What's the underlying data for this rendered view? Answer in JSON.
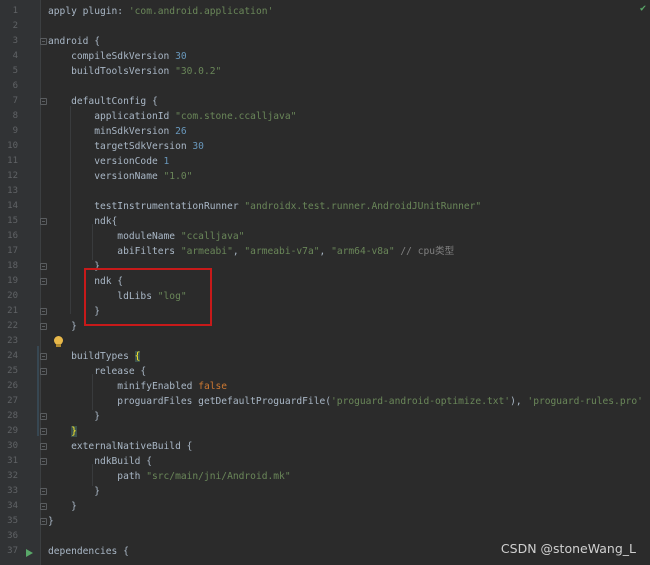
{
  "editor": {
    "lines": [
      {
        "n": "1",
        "segs": [
          [
            "p",
            "apply "
          ],
          [
            "p",
            "plugin: "
          ],
          [
            "s",
            "'com.android.application'"
          ]
        ]
      },
      {
        "n": "2",
        "segs": []
      },
      {
        "n": "3",
        "segs": [
          [
            "p",
            "android {"
          ]
        ]
      },
      {
        "n": "4",
        "segs": [
          [
            "p",
            "    compileSdkVersion "
          ],
          [
            "n",
            "30"
          ]
        ]
      },
      {
        "n": "5",
        "segs": [
          [
            "p",
            "    buildToolsVersion "
          ],
          [
            "s",
            "\"30.0.2\""
          ]
        ]
      },
      {
        "n": "6",
        "segs": []
      },
      {
        "n": "7",
        "segs": [
          [
            "p",
            "    defaultConfig {"
          ]
        ]
      },
      {
        "n": "8",
        "segs": [
          [
            "p",
            "        applicationId "
          ],
          [
            "s",
            "\"com.stone.ccalljava\""
          ]
        ]
      },
      {
        "n": "9",
        "segs": [
          [
            "p",
            "        minSdkVersion "
          ],
          [
            "n",
            "26"
          ]
        ]
      },
      {
        "n": "10",
        "segs": [
          [
            "p",
            "        targetSdkVersion "
          ],
          [
            "n",
            "30"
          ]
        ]
      },
      {
        "n": "11",
        "segs": [
          [
            "p",
            "        versionCode "
          ],
          [
            "n",
            "1"
          ]
        ]
      },
      {
        "n": "12",
        "segs": [
          [
            "p",
            "        versionName "
          ],
          [
            "s",
            "\"1.0\""
          ]
        ]
      },
      {
        "n": "13",
        "segs": []
      },
      {
        "n": "14",
        "segs": [
          [
            "p",
            "        testInstrumentationRunner "
          ],
          [
            "s",
            "\"androidx.test.runner.AndroidJUnitRunner\""
          ]
        ]
      },
      {
        "n": "15",
        "segs": [
          [
            "p",
            "        ndk{"
          ]
        ]
      },
      {
        "n": "16",
        "segs": [
          [
            "p",
            "            moduleName "
          ],
          [
            "s",
            "\"ccalljava\""
          ]
        ]
      },
      {
        "n": "17",
        "segs": [
          [
            "p",
            "            abiFilters "
          ],
          [
            "s",
            "\"armeabi\""
          ],
          [
            "p",
            ", "
          ],
          [
            "s",
            "\"armeabi-v7a\""
          ],
          [
            "p",
            ", "
          ],
          [
            "s",
            "\"arm64-v8a\""
          ],
          [
            "p",
            " "
          ],
          [
            "c",
            "// cpu类型"
          ]
        ]
      },
      {
        "n": "18",
        "segs": [
          [
            "p",
            "        }"
          ]
        ]
      },
      {
        "n": "19",
        "segs": [
          [
            "p",
            "        ndk {"
          ]
        ]
      },
      {
        "n": "20",
        "segs": [
          [
            "p",
            "            ldLibs "
          ],
          [
            "s",
            "\"log\""
          ]
        ]
      },
      {
        "n": "21",
        "segs": [
          [
            "p",
            "        }"
          ]
        ]
      },
      {
        "n": "22",
        "segs": [
          [
            "p",
            "    }"
          ]
        ]
      },
      {
        "n": "23",
        "segs": []
      },
      {
        "n": "24",
        "segs": [
          [
            "p",
            "    buildTypes "
          ],
          [
            "h",
            "{"
          ]
        ]
      },
      {
        "n": "25",
        "segs": [
          [
            "p",
            "        release {"
          ]
        ]
      },
      {
        "n": "26",
        "segs": [
          [
            "p",
            "            minifyEnabled "
          ],
          [
            "k",
            "false"
          ]
        ]
      },
      {
        "n": "27",
        "segs": [
          [
            "p",
            "            proguardFiles getDefaultProguardFile("
          ],
          [
            "s",
            "'proguard-android-optimize.txt'"
          ],
          [
            "p",
            "), "
          ],
          [
            "s",
            "'proguard-rules.pro'"
          ]
        ]
      },
      {
        "n": "28",
        "segs": [
          [
            "p",
            "        }"
          ]
        ]
      },
      {
        "n": "29",
        "segs": [
          [
            "p",
            "    "
          ],
          [
            "h",
            "}"
          ]
        ]
      },
      {
        "n": "30",
        "segs": [
          [
            "p",
            "    externalNativeBuild {"
          ]
        ]
      },
      {
        "n": "31",
        "segs": [
          [
            "p",
            "        ndkBuild {"
          ]
        ]
      },
      {
        "n": "32",
        "segs": [
          [
            "p",
            "            path "
          ],
          [
            "s",
            "\"src/main/jni/Android.mk\""
          ]
        ]
      },
      {
        "n": "33",
        "segs": [
          [
            "p",
            "        }"
          ]
        ]
      },
      {
        "n": "34",
        "segs": [
          [
            "p",
            "    }"
          ]
        ]
      },
      {
        "n": "35",
        "segs": [
          [
            "p",
            "}"
          ]
        ]
      },
      {
        "n": "36",
        "segs": []
      },
      {
        "n": "37",
        "segs": [
          [
            "p",
            "dependencies {"
          ]
        ]
      }
    ],
    "fold_lines": [
      "3",
      "7",
      "15",
      "18",
      "19",
      "21",
      "22",
      "24",
      "25",
      "28",
      "29",
      "30",
      "31",
      "33",
      "34",
      "35"
    ]
  },
  "watermark": "CSDN @stoneWang_L",
  "colors": {
    "background": "#2b2b2b",
    "keyword": "#cc7832",
    "string": "#6a8759",
    "number": "#6897bb",
    "comment": "#808080",
    "highlight_box": "#c71a1a"
  }
}
